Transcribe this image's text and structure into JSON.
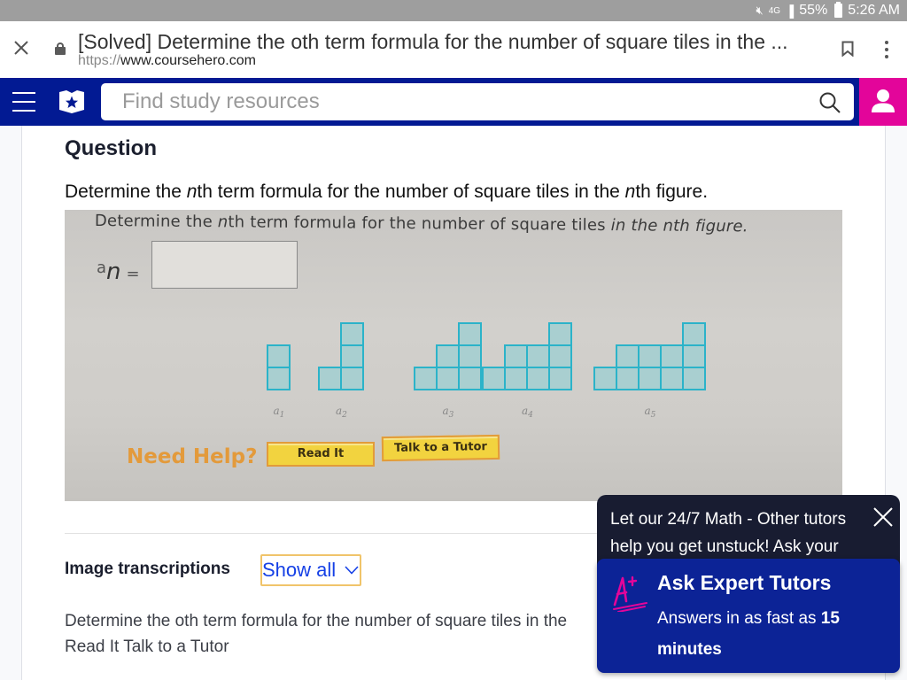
{
  "status_bar": {
    "network": "4G",
    "battery": "55%",
    "time": "5:26 AM"
  },
  "browser": {
    "page_title": "[Solved] Determine the oth term formula for the number of square tiles in the ...",
    "url_scheme": "https://",
    "url_host": "www.coursehero.com"
  },
  "site_nav": {
    "search_placeholder": "Find study resources"
  },
  "question": {
    "heading": "Question",
    "text_before": "Determine the ",
    "text_italic": "n",
    "text_after": "th term formula for the number of square tiles in the ",
    "text_italic2": "n",
    "text_end": "th figure."
  },
  "photo": {
    "prompt_before": "Determine the ",
    "prompt_n": "n",
    "prompt_mid": "th term formula for the number of square tiles ",
    "prompt_in_the": "in the ",
    "prompt_n2": "n",
    "prompt_end": "th figure.",
    "answer_label_a": "a",
    "answer_label_n": "n",
    "answer_label_eq": "=",
    "answer_value": "",
    "figures": [
      {
        "label": "a1",
        "tiles": 2,
        "rows": [
          [
            1
          ],
          [
            1
          ]
        ]
      },
      {
        "label": "a2",
        "tiles": 4,
        "rows": [
          [
            2
          ],
          [
            2
          ],
          [
            1,
            2
          ]
        ]
      },
      {
        "label": "a3",
        "tiles": 6,
        "rows": [
          [
            3
          ],
          [
            2,
            3
          ],
          [
            1,
            2,
            3
          ]
        ]
      },
      {
        "label": "a4",
        "tiles": 8,
        "rows": [
          [
            4
          ],
          [
            2,
            3,
            4
          ],
          [
            1,
            2,
            3,
            4
          ]
        ]
      },
      {
        "label": "a5",
        "tiles": 10,
        "rows": [
          [
            5
          ],
          [
            2,
            3,
            4,
            5
          ],
          [
            1,
            2,
            3,
            4,
            5
          ]
        ]
      }
    ],
    "need_help": "Need Help?",
    "read_it": "Read It",
    "talk_to_tutor": "Talk to a Tutor"
  },
  "transcriptions": {
    "label": "Image transcriptions",
    "show_all": "Show all",
    "line1": "Determine the oth term formula for the number of square tiles in the",
    "line2": "Read It Talk to a Tutor"
  },
  "tutor_popup": {
    "message": "Let our 24/7 Math - Other tutors help you get unstuck! Ask your",
    "title": "Ask Expert Tutors",
    "sub_before": "Answers in as fast as ",
    "sub_bold": "15 minutes"
  },
  "colors": {
    "nav_blue": "#021a93",
    "account_pink": "#e3059a",
    "popup_dark": "#181c31",
    "popup_blue": "#0c2396",
    "tile_teal": "#2bb3c9",
    "link_blue": "#1540e6"
  }
}
